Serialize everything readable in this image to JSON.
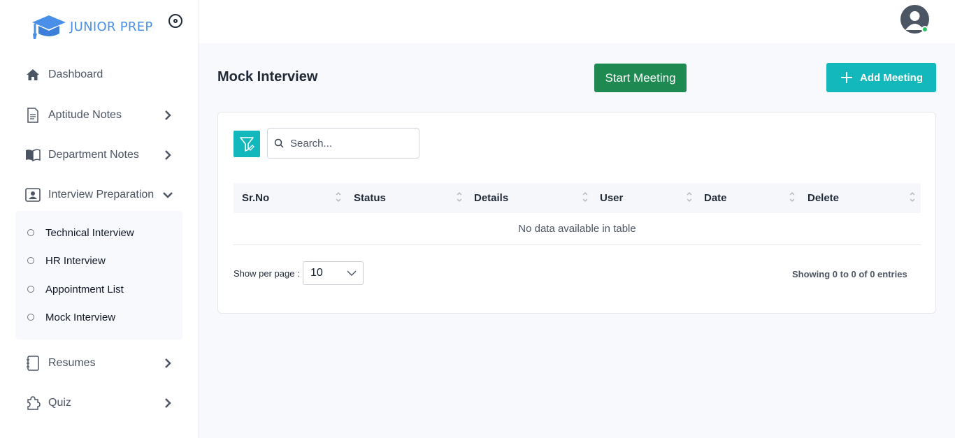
{
  "brand": {
    "name": "JUNIOR PREP"
  },
  "sidebar": {
    "items": [
      {
        "label": "Dashboard",
        "icon": "home-icon"
      },
      {
        "label": "Aptitude Notes",
        "icon": "document-icon"
      },
      {
        "label": "Department Notes",
        "icon": "book-icon"
      },
      {
        "label": "Interview Preparation",
        "icon": "id-card-icon",
        "expanded": true
      },
      {
        "label": "Resumes",
        "icon": "notebook-icon"
      },
      {
        "label": "Quiz",
        "icon": "puzzle-icon"
      }
    ],
    "submenu": [
      {
        "label": "Technical Interview"
      },
      {
        "label": "HR Interview"
      },
      {
        "label": "Appointment List"
      },
      {
        "label": "Mock Interview"
      }
    ]
  },
  "header": {
    "title": "Mock Interview",
    "start_meeting_label": "Start Meeting",
    "add_meeting_label": "Add Meeting"
  },
  "search": {
    "placeholder": "Search..."
  },
  "table": {
    "columns": [
      "Sr.No",
      "Status",
      "Details",
      "User",
      "Date",
      "Delete"
    ],
    "empty_message": "No data available in table"
  },
  "pagination": {
    "per_page_label": "Show per page :",
    "per_page_value": "10",
    "entries_info": "Showing 0 to 0 of 0 entries"
  },
  "colors": {
    "accent_teal": "#13b8bd",
    "start_green": "#1e8a52",
    "brand_blue": "#4a8fe7",
    "online_green": "#22c55e"
  }
}
